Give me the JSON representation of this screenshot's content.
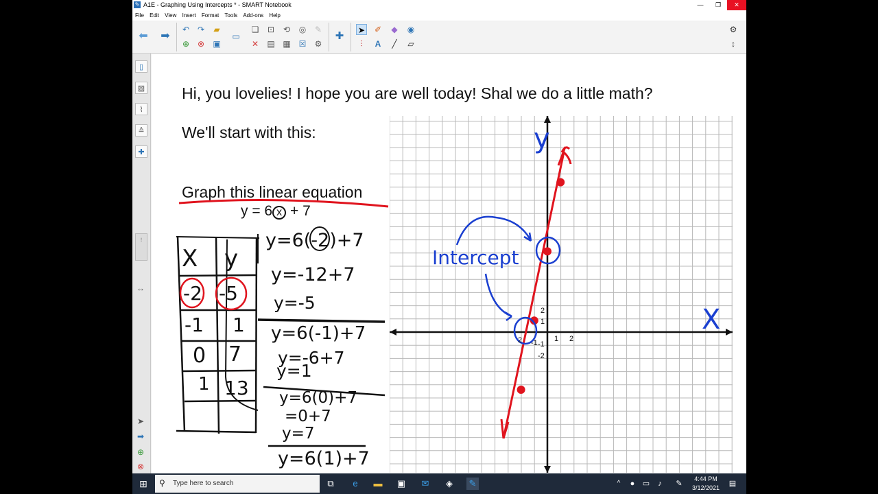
{
  "window": {
    "title": "A1E - Graphing Using Intercepts * - SMART Notebook"
  },
  "menu": [
    "File",
    "Edit",
    "View",
    "Insert",
    "Format",
    "Tools",
    "Add-ons",
    "Help"
  ],
  "slide": {
    "greeting": "Hi, you lovelies! I hope you are well today! Shal we do a little math?",
    "intro": "We'll start with this:",
    "heading": "Graph this linear equation",
    "equation": {
      "left": "y = 6",
      "x": "x",
      "right": "+ 7"
    },
    "table": {
      "headers": [
        "X",
        "y"
      ],
      "rows": [
        [
          "-2",
          "-5"
        ],
        [
          "-1",
          "1"
        ],
        [
          "0",
          "7"
        ],
        [
          "1",
          "13"
        ],
        [
          "",
          ""
        ]
      ]
    },
    "work": [
      "y=6(-2)+7",
      "y=-12+7",
      "y=-5",
      "y=6(-1)+7",
      "y=-6+7",
      "y=1",
      "y=6(0)+7",
      "=0+7",
      "y=7",
      "y=6(1)+7"
    ],
    "graph": {
      "axis_y_label": "y",
      "axis_x_label": "X",
      "annotation": "Intercept",
      "tick_labels": [
        "2",
        "1",
        "-1",
        "-1",
        "-2",
        "1",
        "2",
        "2"
      ],
      "line_color": "#e0141e",
      "ink_color": "#1a3fd0",
      "points": [
        [
          -2,
          -5
        ],
        [
          -1,
          1
        ],
        [
          0,
          7
        ],
        [
          1,
          13
        ]
      ]
    }
  },
  "taskbar": {
    "search_placeholder": "Type here to search",
    "time": "4:44 PM",
    "date": "3/12/2021"
  },
  "colors": {
    "titlebar": "#ffffff",
    "close": "#e81123",
    "taskbar": "#1f2a3a"
  }
}
